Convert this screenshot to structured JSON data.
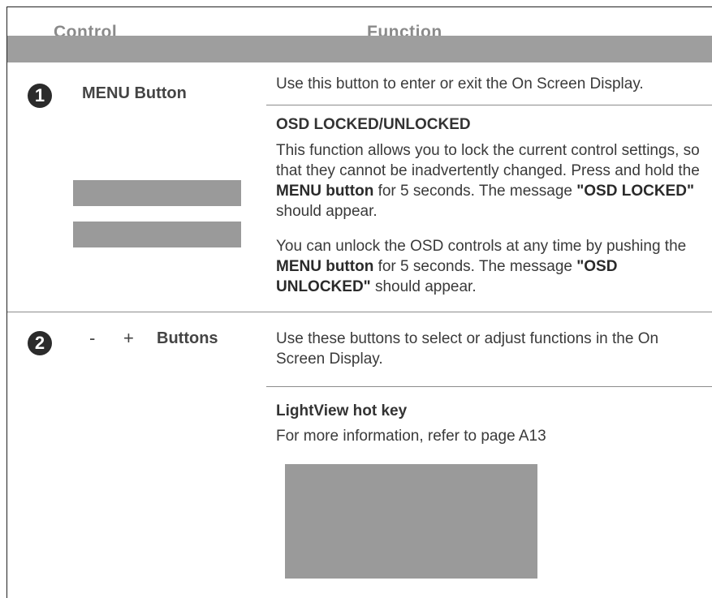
{
  "header": {
    "control_label": "Control",
    "function_label": "Function"
  },
  "rows": [
    {
      "number": "1",
      "control": "MENU Button",
      "description": "Use this button to enter or exit the On Screen Display.",
      "section_title": "OSD LOCKED/UNLOCKED",
      "para1": {
        "t1": "This function allows you to lock the current control settings, so that they cannot be inadvertently changed. Press and hold the ",
        "b1": "MENU button",
        "t2": " for 5 seconds. The message ",
        "b2": "\"OSD LOCKED\"",
        "t3": " should appear."
      },
      "para2": {
        "t1": "You can unlock the OSD controls at any time by pushing the ",
        "b1": "MENU button",
        "t2": " for 5 seconds. The message ",
        "b2": "\"OSD UNLOCKED\"",
        "t3": " should appear."
      }
    },
    {
      "number": "2",
      "minus": "-",
      "plus": "+",
      "control": "Buttons",
      "description": "Use these buttons to select or adjust functions in the On Screen Display.",
      "section_title": "LightView hot key",
      "info": "For more information, refer to page A13"
    }
  ]
}
